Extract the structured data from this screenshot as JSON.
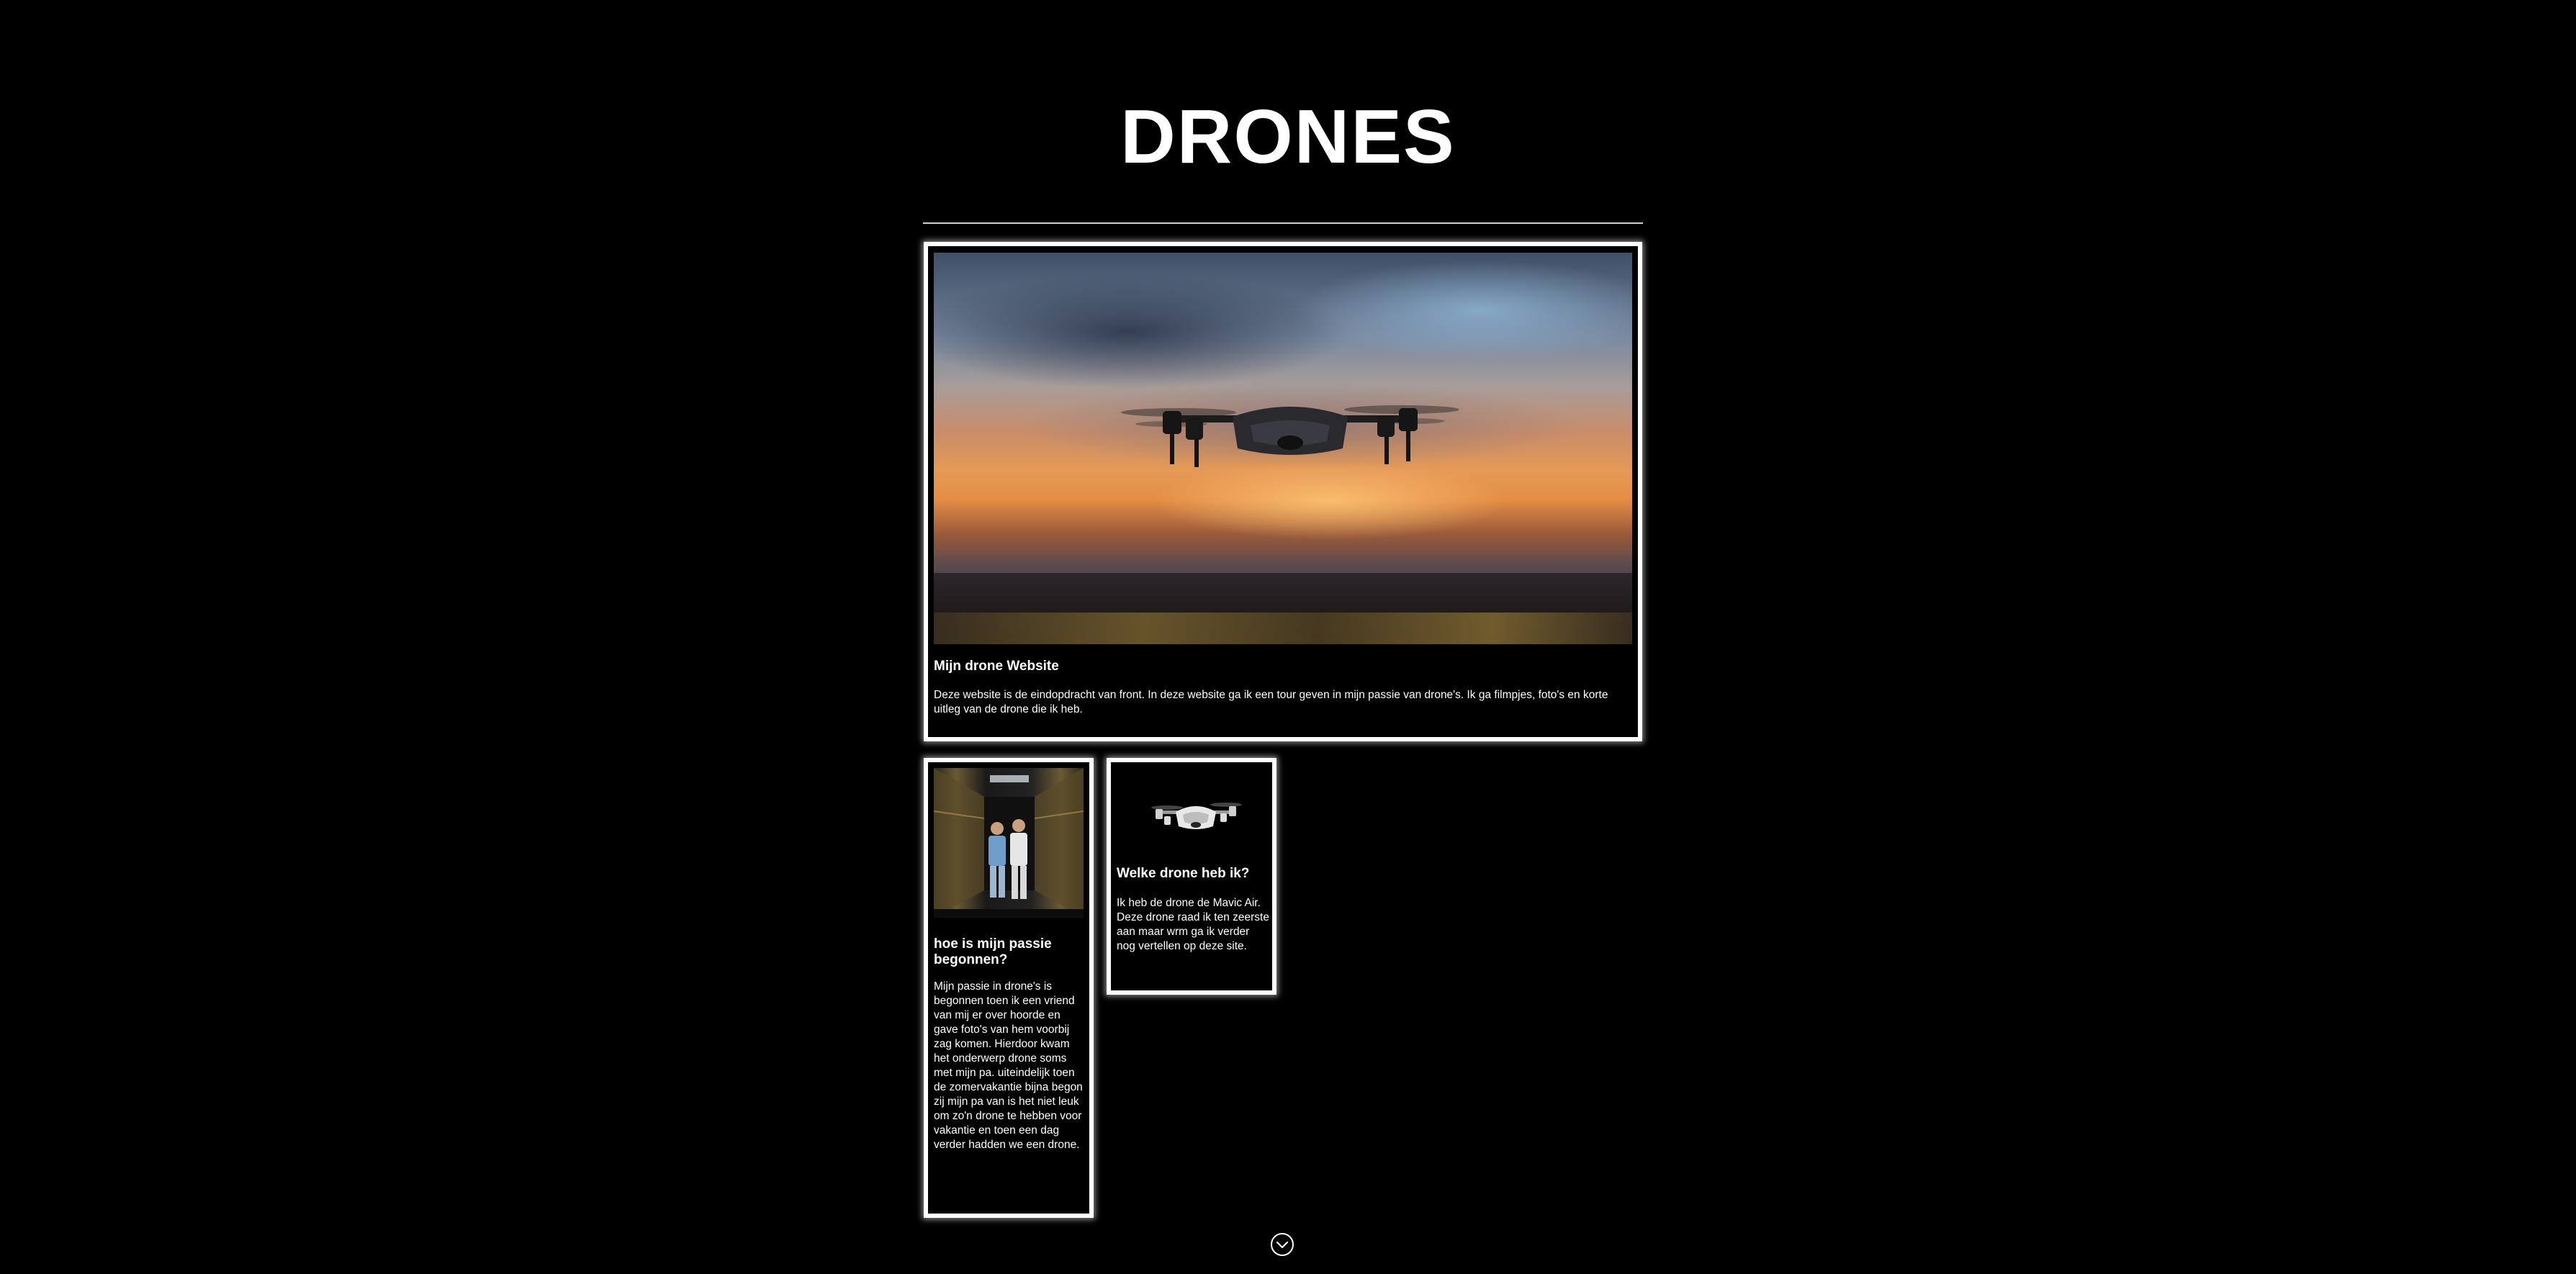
{
  "header": {
    "title": "DRONES"
  },
  "main_card": {
    "image_alt": "drone flying at sunset",
    "title": "Mijn drone Website",
    "text": "Deze website is de eindopdracht van front. In deze website ga ik een tour geven in mijn passie van drone's. Ik ga filmpjes, foto's en korte uitleg van de drone die ik heb."
  },
  "passion_card": {
    "image_alt": "two people in a corridor",
    "title": "hoe is mijn passie begonnen?",
    "text": "Mijn passie in drone's is begonnen toen ik een vriend van mij er over hoorde en gave foto's van hem voorbij zag komen. Hierdoor kwam het onderwerp drone soms met mijn pa. uiteindelijk toen de zomervakantie bijna begon zij mijn pa van is het niet leuk om zo'n drone te hebben voor vakantie en toen een dag verder hadden we een drone."
  },
  "drone_card": {
    "image_alt": "white Mavic Air drone",
    "title": "Welke drone heb ik?",
    "text": "Ik heb de drone de Mavic Air. Deze drone raad ik ten zeerste aan maar wrm ga ik verder nog vertellen op deze site."
  },
  "footer": {
    "scroll_icon": "chevron-down-circle-icon"
  },
  "colors": {
    "background": "#000000",
    "text": "#ffffff",
    "card_border": "#ffffff",
    "divider": "#cfcfcf"
  }
}
